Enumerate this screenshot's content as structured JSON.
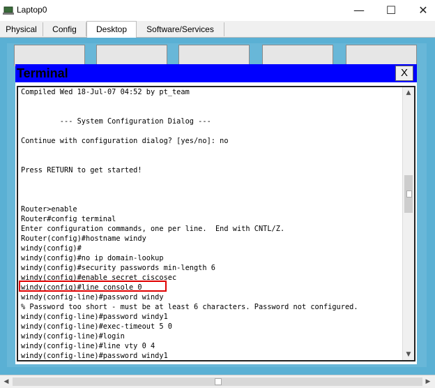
{
  "window": {
    "title": "Laptop0",
    "minimize_glyph": "—",
    "maximize_glyph": "☐",
    "close_glyph": "✕"
  },
  "tabs": [
    {
      "label": "Physical"
    },
    {
      "label": "Config"
    },
    {
      "label": "Desktop"
    },
    {
      "label": "Software/Services"
    }
  ],
  "terminal": {
    "title": "Terminal",
    "close_label": "X",
    "lines": [
      "Compiled Wed 18-Jul-07 04:52 by pt_team",
      "",
      "",
      "         --- System Configuration Dialog ---",
      "",
      "Continue with configuration dialog? [yes/no]: no",
      "",
      "",
      "Press RETURN to get started!",
      "",
      "",
      "",
      "Router>enable",
      "Router#config terminal",
      "Enter configuration commands, one per line.  End with CNTL/Z.",
      "Router(config)#hostname windy",
      "windy(config)#",
      "windy(config)#no ip domain-lookup",
      "windy(config)#security passwords min-length 6",
      "windy(config)#enable secret ciscosec",
      "windy(config)#line console 0",
      "windy(config-line)#password windy",
      "% Password too short - must be at least 6 characters. Password not configured.",
      "windy(config-line)#password windy1",
      "windy(config-line)#exec-timeout 5 0",
      "windy(config-line)#login",
      "windy(config-line)#line vty 0 4",
      "windy(config-line)#password windy1"
    ]
  },
  "icons": {
    "app": "laptop-icon",
    "scroll_up": "▲",
    "scroll_down": "▼",
    "scroll_left": "◀",
    "scroll_right": "▶"
  },
  "colors": {
    "terminal_header": "#0000ff",
    "highlight_box": "#e00000",
    "desktop_bg": "#5ab0d4"
  }
}
